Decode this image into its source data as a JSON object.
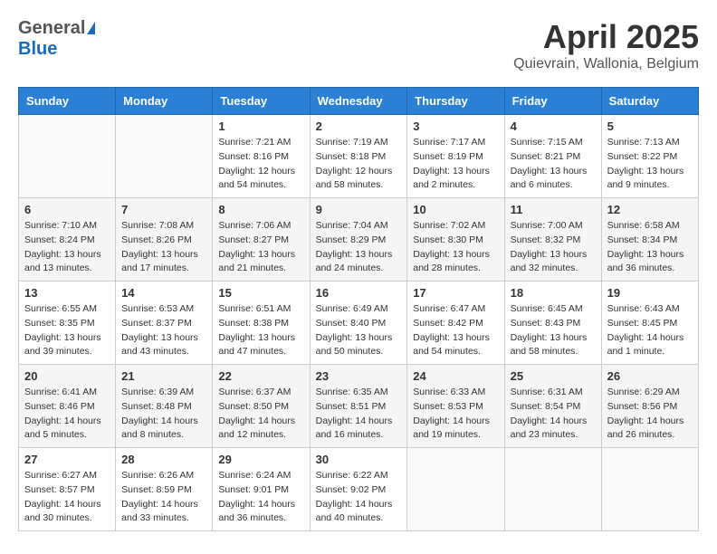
{
  "header": {
    "logo_general": "General",
    "logo_blue": "Blue",
    "month_title": "April 2025",
    "location": "Quievrain, Wallonia, Belgium"
  },
  "calendar": {
    "days_of_week": [
      "Sunday",
      "Monday",
      "Tuesday",
      "Wednesday",
      "Thursday",
      "Friday",
      "Saturday"
    ],
    "weeks": [
      [
        {
          "day": "",
          "info": ""
        },
        {
          "day": "",
          "info": ""
        },
        {
          "day": "1",
          "info": "Sunrise: 7:21 AM\nSunset: 8:16 PM\nDaylight: 12 hours and 54 minutes."
        },
        {
          "day": "2",
          "info": "Sunrise: 7:19 AM\nSunset: 8:18 PM\nDaylight: 12 hours and 58 minutes."
        },
        {
          "day": "3",
          "info": "Sunrise: 7:17 AM\nSunset: 8:19 PM\nDaylight: 13 hours and 2 minutes."
        },
        {
          "day": "4",
          "info": "Sunrise: 7:15 AM\nSunset: 8:21 PM\nDaylight: 13 hours and 6 minutes."
        },
        {
          "day": "5",
          "info": "Sunrise: 7:13 AM\nSunset: 8:22 PM\nDaylight: 13 hours and 9 minutes."
        }
      ],
      [
        {
          "day": "6",
          "info": "Sunrise: 7:10 AM\nSunset: 8:24 PM\nDaylight: 13 hours and 13 minutes."
        },
        {
          "day": "7",
          "info": "Sunrise: 7:08 AM\nSunset: 8:26 PM\nDaylight: 13 hours and 17 minutes."
        },
        {
          "day": "8",
          "info": "Sunrise: 7:06 AM\nSunset: 8:27 PM\nDaylight: 13 hours and 21 minutes."
        },
        {
          "day": "9",
          "info": "Sunrise: 7:04 AM\nSunset: 8:29 PM\nDaylight: 13 hours and 24 minutes."
        },
        {
          "day": "10",
          "info": "Sunrise: 7:02 AM\nSunset: 8:30 PM\nDaylight: 13 hours and 28 minutes."
        },
        {
          "day": "11",
          "info": "Sunrise: 7:00 AM\nSunset: 8:32 PM\nDaylight: 13 hours and 32 minutes."
        },
        {
          "day": "12",
          "info": "Sunrise: 6:58 AM\nSunset: 8:34 PM\nDaylight: 13 hours and 36 minutes."
        }
      ],
      [
        {
          "day": "13",
          "info": "Sunrise: 6:55 AM\nSunset: 8:35 PM\nDaylight: 13 hours and 39 minutes."
        },
        {
          "day": "14",
          "info": "Sunrise: 6:53 AM\nSunset: 8:37 PM\nDaylight: 13 hours and 43 minutes."
        },
        {
          "day": "15",
          "info": "Sunrise: 6:51 AM\nSunset: 8:38 PM\nDaylight: 13 hours and 47 minutes."
        },
        {
          "day": "16",
          "info": "Sunrise: 6:49 AM\nSunset: 8:40 PM\nDaylight: 13 hours and 50 minutes."
        },
        {
          "day": "17",
          "info": "Sunrise: 6:47 AM\nSunset: 8:42 PM\nDaylight: 13 hours and 54 minutes."
        },
        {
          "day": "18",
          "info": "Sunrise: 6:45 AM\nSunset: 8:43 PM\nDaylight: 13 hours and 58 minutes."
        },
        {
          "day": "19",
          "info": "Sunrise: 6:43 AM\nSunset: 8:45 PM\nDaylight: 14 hours and 1 minute."
        }
      ],
      [
        {
          "day": "20",
          "info": "Sunrise: 6:41 AM\nSunset: 8:46 PM\nDaylight: 14 hours and 5 minutes."
        },
        {
          "day": "21",
          "info": "Sunrise: 6:39 AM\nSunset: 8:48 PM\nDaylight: 14 hours and 8 minutes."
        },
        {
          "day": "22",
          "info": "Sunrise: 6:37 AM\nSunset: 8:50 PM\nDaylight: 14 hours and 12 minutes."
        },
        {
          "day": "23",
          "info": "Sunrise: 6:35 AM\nSunset: 8:51 PM\nDaylight: 14 hours and 16 minutes."
        },
        {
          "day": "24",
          "info": "Sunrise: 6:33 AM\nSunset: 8:53 PM\nDaylight: 14 hours and 19 minutes."
        },
        {
          "day": "25",
          "info": "Sunrise: 6:31 AM\nSunset: 8:54 PM\nDaylight: 14 hours and 23 minutes."
        },
        {
          "day": "26",
          "info": "Sunrise: 6:29 AM\nSunset: 8:56 PM\nDaylight: 14 hours and 26 minutes."
        }
      ],
      [
        {
          "day": "27",
          "info": "Sunrise: 6:27 AM\nSunset: 8:57 PM\nDaylight: 14 hours and 30 minutes."
        },
        {
          "day": "28",
          "info": "Sunrise: 6:26 AM\nSunset: 8:59 PM\nDaylight: 14 hours and 33 minutes."
        },
        {
          "day": "29",
          "info": "Sunrise: 6:24 AM\nSunset: 9:01 PM\nDaylight: 14 hours and 36 minutes."
        },
        {
          "day": "30",
          "info": "Sunrise: 6:22 AM\nSunset: 9:02 PM\nDaylight: 14 hours and 40 minutes."
        },
        {
          "day": "",
          "info": ""
        },
        {
          "day": "",
          "info": ""
        },
        {
          "day": "",
          "info": ""
        }
      ]
    ]
  }
}
